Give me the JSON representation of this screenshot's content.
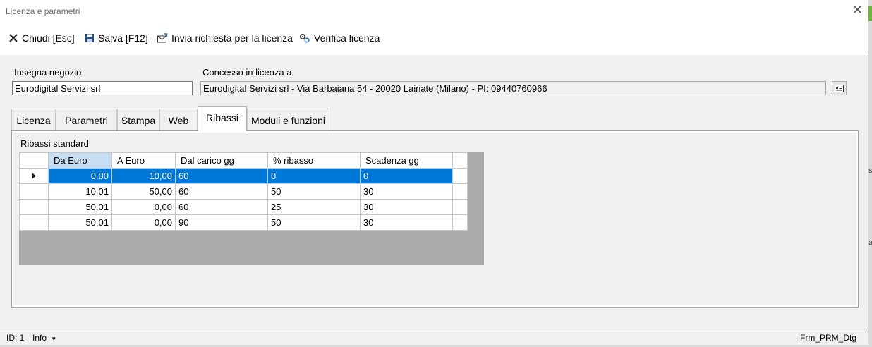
{
  "window": {
    "title": "Licenza e parametri"
  },
  "toolbar": {
    "close_label": "Chiudi [Esc]",
    "save_label": "Salva [F12]",
    "send_label": "Invia richiesta per la licenza",
    "verify_label": "Verifica licenza"
  },
  "form": {
    "shop_sign_label": "Insegna negozio",
    "shop_sign_value": "Eurodigital Servizi srl",
    "licensed_to_label": "Concesso in licenza a",
    "licensed_to_value": "Eurodigital Servizi srl - Via Barbaiana 54 - 20020 Lainate (Milano) - PI: 09440760966"
  },
  "tabs": [
    "Licenza",
    "Parametri",
    "Stampa",
    "Web",
    "Ribassi",
    "Moduli e funzioni"
  ],
  "active_tab": "Ribassi",
  "ribassi": {
    "group_label": "Ribassi standard",
    "columns": [
      "Da Euro",
      "A Euro",
      "Dal carico gg",
      "% ribasso",
      "Scadenza gg"
    ],
    "rows": [
      [
        "0,00",
        "10,00",
        "60",
        "0",
        "0"
      ],
      [
        "10,01",
        "50,00",
        "60",
        "50",
        "30"
      ],
      [
        "50,01",
        "0,00",
        "60",
        "25",
        "30"
      ],
      [
        "50,01",
        "0,00",
        "90",
        "50",
        "30"
      ]
    ]
  },
  "statusbar": {
    "id_text": "ID: 1",
    "info_label": "Info",
    "form_name": "Frm_PRM_Dtg"
  },
  "colors": {
    "selection": "#0078d7",
    "header_selected": "#c7ddf2",
    "grid_bg": "#ababab"
  }
}
